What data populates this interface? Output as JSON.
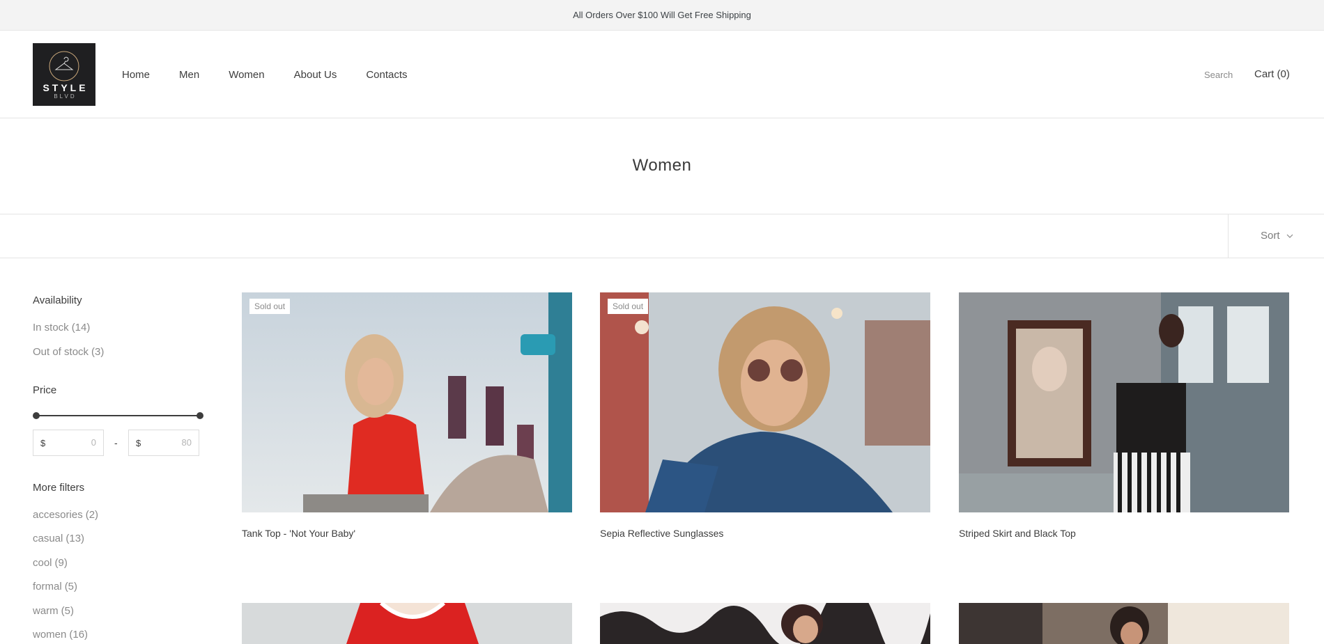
{
  "announcement": "All Orders Over $100 Will Get Free Shipping",
  "logo": {
    "main": "STYLE",
    "sub": "BLVD",
    "icon": "hanger-icon"
  },
  "nav": [
    "Home",
    "Men",
    "Women",
    "About Us",
    "Contacts"
  ],
  "header": {
    "search": "Search",
    "cart": "Cart (0)"
  },
  "page_title": "Women",
  "sort": {
    "label": "Sort",
    "icon": "chevron-down-icon"
  },
  "filters": {
    "availability": {
      "heading": "Availability",
      "options": [
        {
          "label": "In stock",
          "count": "(14)"
        },
        {
          "label": "Out of stock",
          "count": "(3)"
        }
      ]
    },
    "price": {
      "heading": "Price",
      "currency": "$",
      "separator": "-",
      "min_placeholder": "0",
      "max_placeholder": "80",
      "range_fraction": [
        0,
        1
      ]
    },
    "more": {
      "heading": "More filters",
      "options": [
        {
          "label": "accesories",
          "count": "(2)"
        },
        {
          "label": "casual",
          "count": "(13)"
        },
        {
          "label": "cool",
          "count": "(9)"
        },
        {
          "label": "formal",
          "count": "(5)"
        },
        {
          "label": "warm",
          "count": "(5)"
        },
        {
          "label": "women",
          "count": "(16)"
        }
      ]
    }
  },
  "products": [
    {
      "title": "Tank Top - 'Not Your Baby'",
      "badge": "Sold out"
    },
    {
      "title": "Sepia Reflective Sunglasses",
      "badge": "Sold out"
    },
    {
      "title": "Striped Skirt and Black Top",
      "badge": ""
    },
    {
      "title": "",
      "badge": ""
    },
    {
      "title": "",
      "badge": ""
    },
    {
      "title": "",
      "badge": ""
    }
  ],
  "colors": {
    "announcement_bg": "#f3f3f3",
    "text": "#3d3d3d",
    "muted": "#8a8a8a",
    "border": "#e4e4e4",
    "logo_bg": "#1f1f21"
  }
}
